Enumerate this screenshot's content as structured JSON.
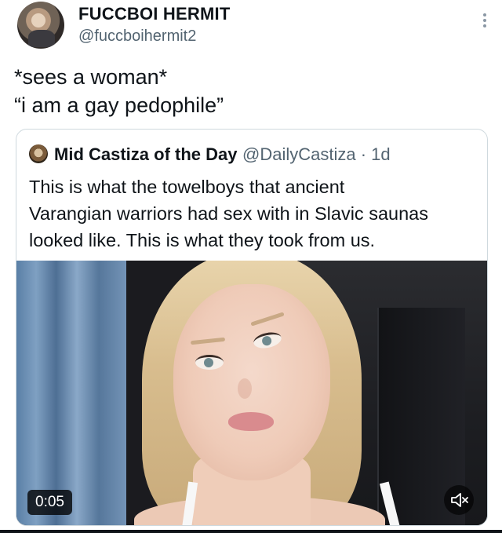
{
  "tweet": {
    "display_name": "FUCCBOI HERMIT",
    "handle": "@fuccboihermit2",
    "text_lines": [
      "*sees a woman*",
      "“i am a gay pedophile”"
    ]
  },
  "quoted_tweet": {
    "display_name": "Mid Castiza of the Day",
    "handle": "@DailyCastiza",
    "separator": "·",
    "age": "1d",
    "text_lines": [
      "This is what the towelboys that ancient",
      "Varangian warriors had sex with in Slavic saunas",
      "looked like. This is what they took from us."
    ],
    "video": {
      "duration": "0:05",
      "mute_icon": "speaker-muted-icon"
    }
  },
  "icons": {
    "more": "more-vertical-icon"
  },
  "colors": {
    "text": "#0f1419",
    "secondary": "#536471",
    "border": "#cfd9de"
  }
}
